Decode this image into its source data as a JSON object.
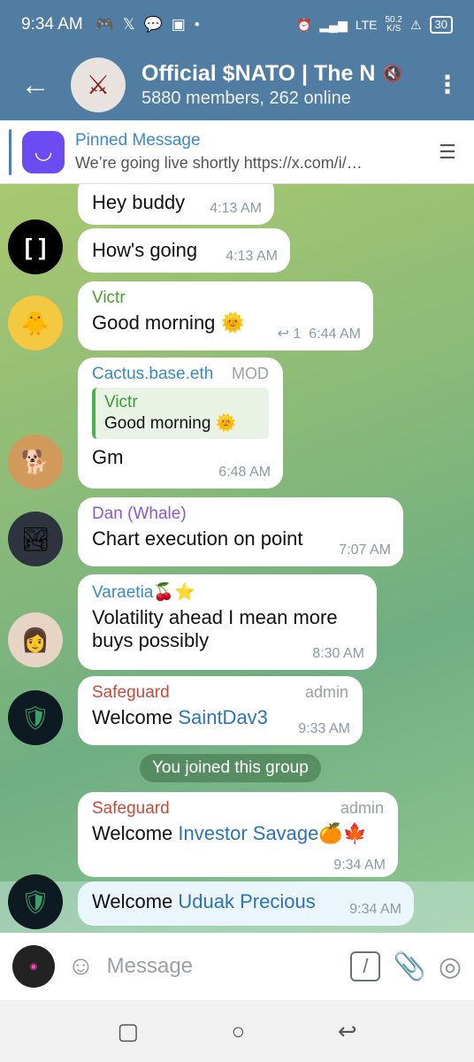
{
  "statusbar": {
    "time": "9:34 AM",
    "dot": "•",
    "lte": "LTE",
    "speed": "50.2",
    "speed_unit": "K/S",
    "battery": "30"
  },
  "header": {
    "back": "←",
    "title": "Official $NATO | The N",
    "subtitle": "5880 members, 262 online",
    "menu": "⋮"
  },
  "pinned": {
    "title": "Pinned Message",
    "text": "We’re going live shortly https://x.com/i/…"
  },
  "messages": [
    {
      "text": "Hey buddy",
      "time": "4:13 AM"
    },
    {
      "text": "How's going",
      "time": "4:13 AM"
    },
    {
      "sender": "Victr",
      "text": "Good morning 🌞",
      "replies": "1",
      "time": "6:44 AM"
    },
    {
      "sender": "Cactus.base.eth",
      "role": "MOD",
      "quote_name": "Victr",
      "quote_text": "Good morning 🌞",
      "text": "Gm",
      "time": "6:48 AM"
    },
    {
      "sender": "Dan (Whale)",
      "text": "Chart execution on point",
      "time": "7:07 AM"
    },
    {
      "sender": "Varaetia🍒⭐",
      "text": "Volatility ahead I mean more buys possibly",
      "time": "8:30 AM"
    },
    {
      "sender": "Safeguard",
      "role": "admin",
      "text": "Welcome ",
      "mention": "SaintDav3",
      "time": "9:33 AM"
    },
    {
      "sender": "Safeguard",
      "role": "admin",
      "text": "Welcome ",
      "mention": "Investor Savage🍊🍁",
      "time": "9:34 AM"
    },
    {
      "text": "Welcome ",
      "mention": "Uduak Precious",
      "time": "9:34 AM"
    }
  ],
  "system_message": "You joined this group",
  "input": {
    "placeholder": "Message"
  }
}
